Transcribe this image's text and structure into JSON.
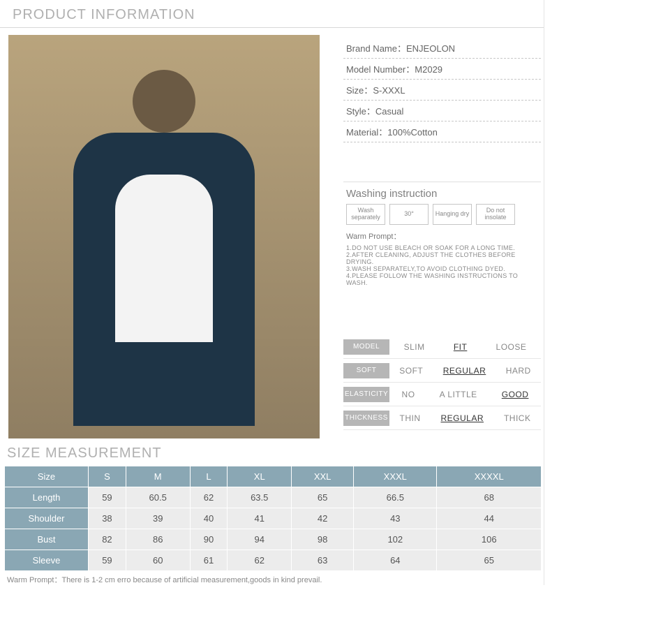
{
  "section_product_info": "PRODUCT INFORMATION",
  "specs": {
    "brand_label": "Brand Name",
    "brand_value": "ENJEOLON",
    "model_label": "Model Number",
    "model_value": "M2029",
    "size_label": "Size",
    "size_value": "S-XXXL",
    "style_label": "Style",
    "style_value": "Casual",
    "material_label": "Material",
    "material_value": "100%Cotton"
  },
  "wash": {
    "title": "Washing instruction",
    "boxes": [
      "Wash separately",
      "30°",
      "Hanging dry",
      "Do not insolate"
    ],
    "warm_label": "Warm Prompt",
    "rules": [
      "1.DO NOT USE BLEACH OR SOAK FOR A LONG TIME.",
      "2.AFTER CLEANING, ADJUST THE CLOTHES BEFORE DRYING.",
      "3.WASH SEPARATELY,TO AVOID CLOTHING DYED.",
      "4.PLEASE FOLLOW THE WASHING INSTRUCTIONS TO WASH."
    ]
  },
  "attrs": {
    "rows": [
      {
        "label": "MODEL",
        "opts": [
          "SLIM",
          "FIT",
          "LOOSE"
        ],
        "sel": 1
      },
      {
        "label": "SOFT",
        "opts": [
          "SOFT",
          "REGULAR",
          "HARD"
        ],
        "sel": 1
      },
      {
        "label": "ELASTICITY",
        "opts": [
          "NO",
          "A LITTLE",
          "GOOD"
        ],
        "sel": 2
      },
      {
        "label": "THICKNESS",
        "opts": [
          "THIN",
          "REGULAR",
          "THICK"
        ],
        "sel": 1
      }
    ]
  },
  "section_size": "SIZE MEASUREMENT",
  "chart_data": {
    "type": "table",
    "title": "SIZE MEASUREMENT",
    "columns": [
      "Size",
      "S",
      "M",
      "L",
      "XL",
      "XXL",
      "XXXL",
      "XXXXL"
    ],
    "rows": [
      {
        "label": "Length",
        "values": [
          59,
          60.5,
          62,
          63.5,
          65,
          66.5,
          68
        ]
      },
      {
        "label": "Shoulder",
        "values": [
          38,
          39,
          40,
          41,
          42,
          43,
          44
        ]
      },
      {
        "label": "Bust",
        "values": [
          82,
          86,
          90,
          94,
          98,
          102,
          106
        ]
      },
      {
        "label": "Sleeve",
        "values": [
          59,
          60,
          61,
          62,
          63,
          64,
          65
        ]
      }
    ]
  },
  "prompt": {
    "label": "Warm Prompt",
    "text": "There is 1-2 cm erro because of artificial measurement,goods in kind prevail."
  }
}
